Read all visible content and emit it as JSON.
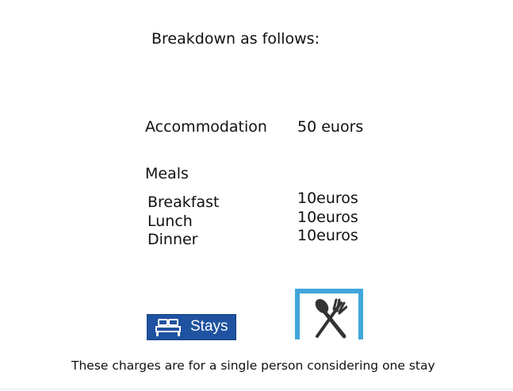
{
  "heading": "Breakdown as follows:",
  "accommodation": {
    "label": "Accommodation",
    "price": "50 euors"
  },
  "meals": {
    "label": "Meals",
    "items": [
      {
        "name": "Breakfast",
        "price": "10euros"
      },
      {
        "name": "Lunch",
        "price": "10euros"
      },
      {
        "name": "Dinner",
        "price": "10euros"
      }
    ]
  },
  "icons": {
    "stays_badge": {
      "icon": "bed-icon",
      "label": "Stays",
      "color": "#1f52a0"
    },
    "meals_badge": {
      "icon": "utensils-icon",
      "color": "#40a6dc"
    }
  },
  "footnote": "These charges are for a single person considering one stay"
}
